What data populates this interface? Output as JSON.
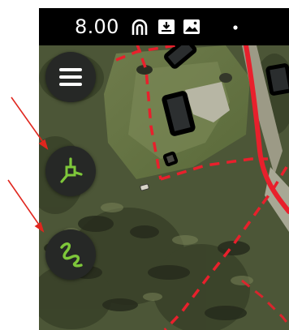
{
  "status_bar": {
    "time": "8.00",
    "icons": [
      "arch-app-icon",
      "download-icon",
      "image-icon",
      "notification-dot-icon"
    ]
  },
  "map": {
    "view": "satellite",
    "route_color": "#e8202c",
    "trail_style": "dashed-red"
  },
  "buttons": [
    {
      "icon": "menu-icon",
      "color": "#ffffff"
    },
    {
      "icon": "waypoint-node-icon",
      "color": "#7ec73a"
    },
    {
      "icon": "freehand-draw-icon",
      "color": "#7ec73a"
    }
  ],
  "annotations": {
    "arrow_color": "#e0261e",
    "targets": [
      "waypoint-node-button",
      "freehand-draw-button"
    ]
  }
}
